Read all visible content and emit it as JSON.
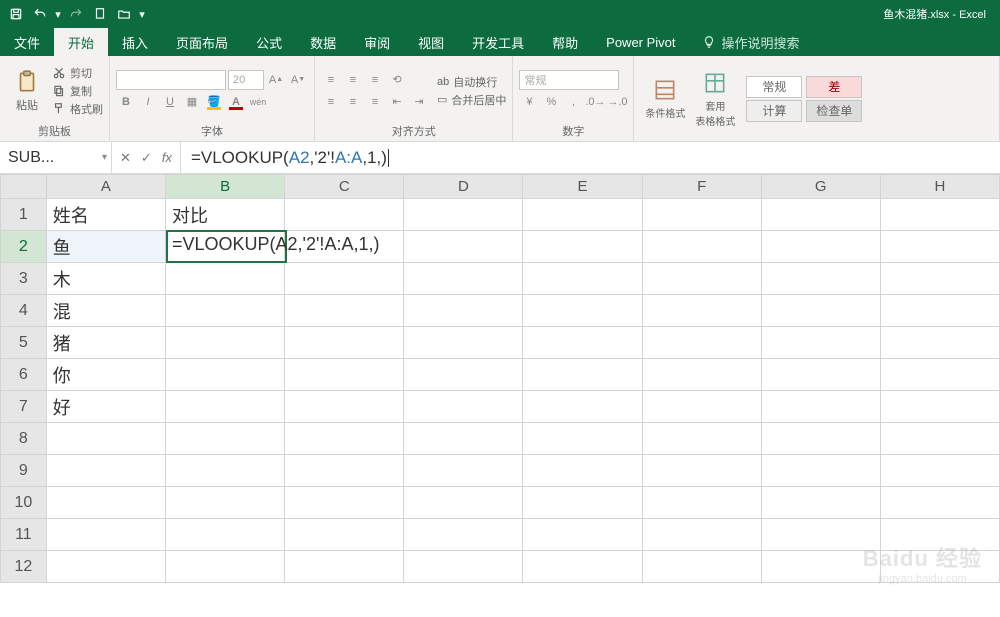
{
  "title": {
    "filename": "鱼木混猪.xlsx",
    "app": "Excel"
  },
  "qat": {
    "save": "save-icon",
    "undo": "undo-icon",
    "redo": "redo-icon",
    "new": "new-icon",
    "open": "open-icon"
  },
  "tabs": {
    "file": "文件",
    "home": "开始",
    "insert": "插入",
    "pagelayout": "页面布局",
    "formulas": "公式",
    "data": "数据",
    "review": "审阅",
    "view": "视图",
    "developer": "开发工具",
    "help": "帮助",
    "powerpivot": "Power Pivot",
    "tellme": "操作说明搜索"
  },
  "ribbon": {
    "clipboard": {
      "label": "剪贴板",
      "paste": "粘贴",
      "cut": "剪切",
      "copy": "复制",
      "painter": "格式刷"
    },
    "font": {
      "label": "字体",
      "size": "20",
      "wen": "wén"
    },
    "alignment": {
      "label": "对齐方式",
      "wrap": "自动换行",
      "merge": "合并后居中"
    },
    "number": {
      "label": "数字",
      "format": "常规"
    },
    "styles": {
      "cond": "条件格式",
      "tablefmt": "套用\n表格格式",
      "normal": "常规",
      "calc": "计算",
      "check": "检查单"
    }
  },
  "formulabar": {
    "namebox": "SUB...",
    "cancel": "✕",
    "enter": "✓",
    "fx": "fx",
    "formula_display": "=VLOOKUP(A2,'2'!A:A,1,)"
  },
  "grid": {
    "columns": [
      "A",
      "B",
      "C",
      "D",
      "E",
      "F",
      "G",
      "H"
    ],
    "rows": [
      1,
      2,
      3,
      4,
      5,
      6,
      7,
      8,
      9,
      10,
      11,
      12
    ],
    "active_col": "B",
    "active_row": 2,
    "cells": {
      "A1": "姓名",
      "B1": "对比",
      "A2": "鱼",
      "B2": "=VLOOKUP(A2,'2'!A:A,1,)",
      "A3": "木",
      "A4": "混",
      "A5": "猪",
      "A6": "你",
      "A7": "好"
    }
  },
  "watermark": {
    "brand": "Baidu 经验",
    "url": "jingyan.baidu.com"
  }
}
